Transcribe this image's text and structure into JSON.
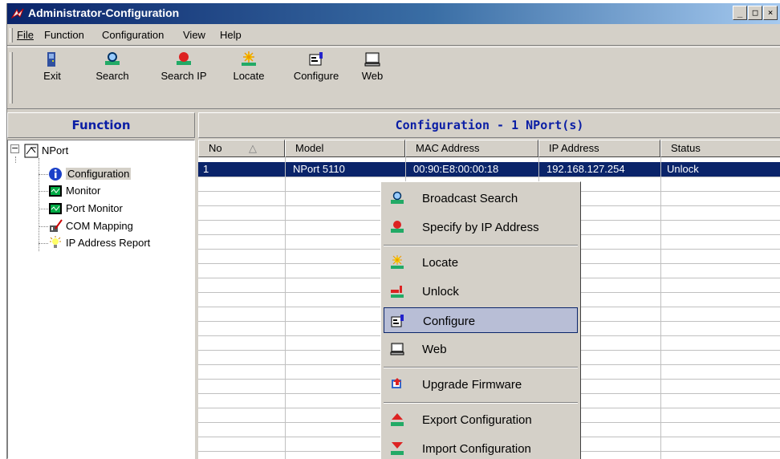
{
  "window": {
    "title": "Administrator-Configuration"
  },
  "menubar": [
    {
      "label": "File",
      "id": "file"
    },
    {
      "label": "Function",
      "id": "function"
    },
    {
      "label": "Configuration",
      "id": "configuration"
    },
    {
      "label": "View",
      "id": "view"
    },
    {
      "label": "Help",
      "id": "help"
    }
  ],
  "toolbar": {
    "exit": "Exit",
    "search": "Search",
    "search_ip": "Search IP",
    "locate": "Locate",
    "configure": "Configure",
    "web": "Web"
  },
  "left_panel": {
    "header": "Function",
    "tree": {
      "root": "NPort",
      "children": [
        "Configuration",
        "Monitor",
        "Port Monitor",
        "COM Mapping",
        "IP Address Report"
      ]
    }
  },
  "main": {
    "header": "Configuration - 1 NPort(s)",
    "columns": [
      "No",
      "Model",
      "MAC Address",
      "IP Address",
      "Status"
    ],
    "rows": [
      {
        "no": "1",
        "model": "NPort 5110",
        "mac": "00:90:E8:00:00:18",
        "ip": "192.168.127.254",
        "status": "Unlock"
      }
    ]
  },
  "context_menu": {
    "items": [
      "Broadcast Search",
      "Specify by IP Address",
      "Locate",
      "Unlock",
      "Configure",
      "Web",
      "Upgrade Firmware",
      "Export Configuration",
      "Import Configuration"
    ],
    "highlighted": "Configure"
  },
  "colors": {
    "title_gradient_start": "#0a246a",
    "header_text": "#0a1ea5",
    "selection": "#0a246a",
    "menu_highlight": "#b8bed6"
  }
}
